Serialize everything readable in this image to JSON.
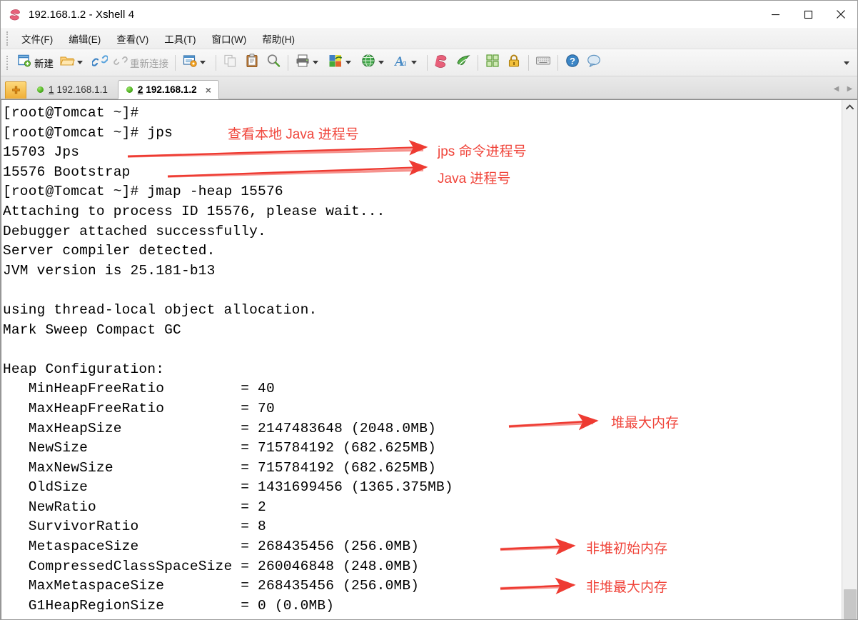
{
  "window": {
    "title": "192.168.1.2 - Xshell 4",
    "app_icon": "xshell-logo-icon",
    "minimize_label": "—",
    "maximize_label": "□",
    "close_label": "✕"
  },
  "menubar": {
    "items": [
      {
        "label": "文件(F)",
        "name": "menu-file"
      },
      {
        "label": "编辑(E)",
        "name": "menu-edit"
      },
      {
        "label": "查看(V)",
        "name": "menu-view"
      },
      {
        "label": "工具(T)",
        "name": "menu-tools"
      },
      {
        "label": "窗口(W)",
        "name": "menu-window"
      },
      {
        "label": "帮助(H)",
        "name": "menu-help"
      }
    ]
  },
  "toolbar": {
    "new_label": "新建",
    "reconnect_label": "重新连接",
    "items": [
      {
        "name": "new-session-button",
        "icon": "new-window-icon",
        "label": "新建"
      },
      {
        "name": "open-session-button",
        "icon": "open-folder-icon",
        "dropdown": true
      },
      {
        "name": "connect-button",
        "icon": "link-connect-icon"
      },
      {
        "name": "reconnect-button",
        "icon": "link-broken-icon",
        "label": "重新连接",
        "disabled": true
      },
      {
        "name": "session-properties-button",
        "icon": "properties-window-icon",
        "dropdown": true
      },
      {
        "name": "copy-button",
        "icon": "copy-icon",
        "disabled": true
      },
      {
        "name": "paste-button",
        "icon": "clipboard-paste-icon"
      },
      {
        "name": "find-button",
        "icon": "magnifier-search-icon"
      },
      {
        "name": "print-button",
        "icon": "printer-icon",
        "dropdown": true
      },
      {
        "name": "transfer-button",
        "icon": "color-blocks-transfer-icon",
        "dropdown": true
      },
      {
        "name": "browser-button",
        "icon": "globe-icon",
        "dropdown": true
      },
      {
        "name": "font-button",
        "icon": "font-letter-a-icon",
        "dropdown": true
      },
      {
        "name": "xshell-button",
        "icon": "xshell-logo-icon"
      },
      {
        "name": "xftp-button",
        "icon": "xftp-green-icon"
      },
      {
        "name": "layout-button",
        "icon": "layout-grid-icon"
      },
      {
        "name": "lock-button",
        "icon": "padlock-icon"
      },
      {
        "name": "keyboard-button",
        "icon": "keyboard-icon"
      },
      {
        "name": "help-button",
        "icon": "help-question-icon"
      },
      {
        "name": "chat-button",
        "icon": "chat-bubble-icon"
      }
    ],
    "overflow_label": "▾"
  },
  "tabbar": {
    "add_tab_label": "+",
    "tabs": [
      {
        "index": "1",
        "label": "192.168.1.1",
        "active": false,
        "name": "tab-session-1"
      },
      {
        "index": "2",
        "label": "192.168.1.2",
        "active": true,
        "name": "tab-session-2"
      }
    ],
    "close_label": "×",
    "scroll_left_label": "◀",
    "scroll_right_label": "▶"
  },
  "terminal": {
    "lines": [
      "[root@Tomcat ~]#",
      "[root@Tomcat ~]# jps",
      "15703 Jps",
      "15576 Bootstrap",
      "[root@Tomcat ~]# jmap -heap 15576",
      "Attaching to process ID 15576, please wait...",
      "Debugger attached successfully.",
      "Server compiler detected.",
      "JVM version is 25.181-b13",
      "",
      "using thread-local object allocation.",
      "Mark Sweep Compact GC",
      "",
      "Heap Configuration:",
      "   MinHeapFreeRatio         = 40",
      "   MaxHeapFreeRatio         = 70",
      "   MaxHeapSize              = 2147483648 (2048.0MB)",
      "   NewSize                  = 715784192 (682.625MB)",
      "   MaxNewSize               = 715784192 (682.625MB)",
      "   OldSize                  = 1431699456 (1365.375MB)",
      "   NewRatio                 = 2",
      "   SurvivorRatio            = 8",
      "   MetaspaceSize            = 268435456 (256.0MB)",
      "   CompressedClassSpaceSize = 260046848 (248.0MB)",
      "   MaxMetaspaceSize         = 268435456 (256.0MB)",
      "   G1HeapRegionSize         = 0 (0.0MB)"
    ]
  },
  "annotations": {
    "color": "#f0463c",
    "labels": [
      {
        "text": "查看本地 Java 进程号",
        "name": "annotation-jps-command"
      },
      {
        "text": "jps 命令进程号",
        "name": "annotation-jps-pid"
      },
      {
        "text": "Java 进程号",
        "name": "annotation-java-pid"
      },
      {
        "text": "堆最大内存",
        "name": "annotation-max-heap"
      },
      {
        "text": "非堆初始内存",
        "name": "annotation-metaspace-initial"
      },
      {
        "text": "非堆最大内存",
        "name": "annotation-metaspace-max"
      }
    ]
  },
  "scrollbar": {
    "up_arrow_label": "⌃",
    "position": "bottom"
  }
}
